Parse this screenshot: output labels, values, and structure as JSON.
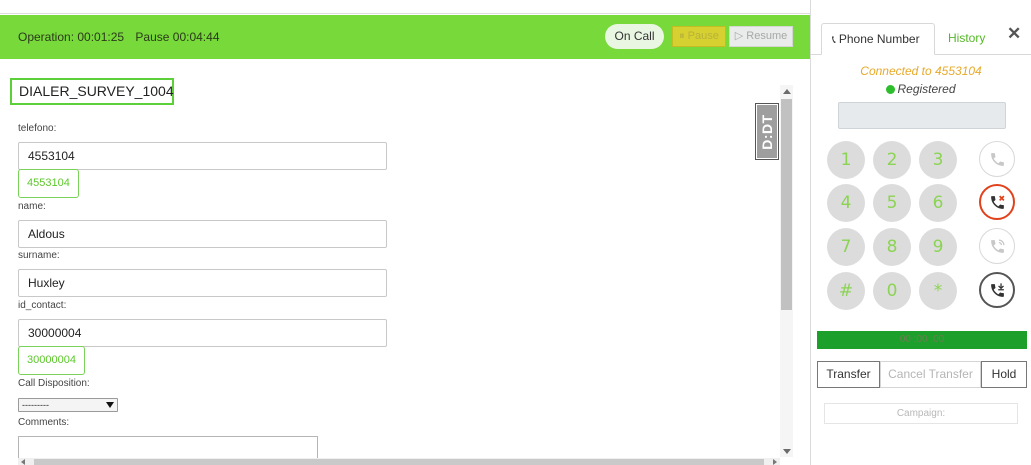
{
  "operation_bar": {
    "operation_label": "Operation: 00:01:25",
    "pause_time_label": "Pause 00:04:44",
    "status_label": "On Call",
    "pause_button": "⏸ Pause",
    "resume_button": "▷ Resume"
  },
  "form": {
    "title": "DIALER_SURVEY_1004",
    "fields": [
      {
        "label": "telefono:",
        "value": "4553104",
        "chip": "4553104"
      },
      {
        "label": "name:",
        "value": "Aldous"
      },
      {
        "label": "surname:",
        "value": "Huxley"
      },
      {
        "label": "id_contact:",
        "value": "30000004",
        "chip": "30000004"
      }
    ],
    "disposition_label": "Call Disposition:",
    "disposition_selected": "---------",
    "comments_label": "Comments:",
    "comments_value": ""
  },
  "side_logo": "D:DT",
  "phone": {
    "tab_phone": "Phone Number",
    "tab_history": "History",
    "close": "✕",
    "connected": "Connected to 4553104",
    "registered": "Registered",
    "dial_value": "",
    "keys": [
      "1",
      "2",
      "3",
      "4",
      "5",
      "6",
      "7",
      "8",
      "9",
      "#",
      "0",
      "*"
    ],
    "timer": "00 :00 :00",
    "transfer": "Transfer",
    "cancel_transfer": "Cancel Transfer",
    "hold": "Hold",
    "campaign_placeholder": "Campaign:"
  },
  "colors": {
    "accent_green": "#77d93a",
    "connected_orange": "#e8a92a",
    "hangup_red": "#e0421c",
    "timer_green": "#1c9f2b"
  },
  "icons": {
    "call": "phone-icon",
    "hangup": "phone-hangup-icon",
    "callback": "phone-callback-icon",
    "incoming": "phone-incoming-icon"
  }
}
